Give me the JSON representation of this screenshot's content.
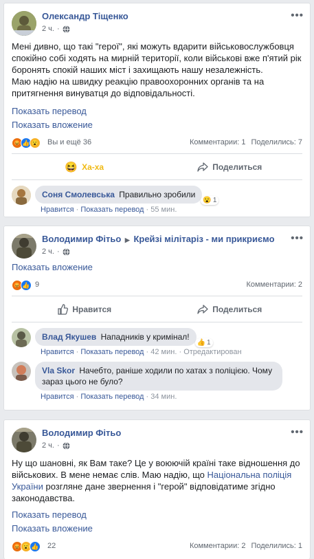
{
  "post1": {
    "author": "Олександр Тіщенко",
    "time": "2 ч.",
    "text_lines": [
      "Мені дивно, що такі \"герої\", які можуть вдарити військовослужбовця",
      "спокійно собі ходять на мирній території, коли військові вже п'ятий рік",
      "боронять спокій наших міст і захищають нашу незалежність.",
      "Маю надію на швидку реакцію правоохоронних органів та на",
      "притягнення винуватця до відповідальності."
    ],
    "see_translation": "Показать перевод",
    "see_attachment": "Показать вложение",
    "reactions_text": "Вы и ещё 36",
    "comments_count": "Комментарии: 1",
    "shares_count": "Поделились: 7",
    "action_reaction": "Ха-ха",
    "action_share": "Поделиться",
    "comments": [
      {
        "name": "Соня Смолевська",
        "text": "Правильно зробили",
        "react_count": "1",
        "like": "Нравится",
        "translate": "Показать перевод",
        "time": "55 мин."
      }
    ]
  },
  "post2": {
    "author": "Володимир Фітьо",
    "group": "Крейзі мілітаріз - ми прикриємо",
    "time": "2 ч.",
    "see_attachment": "Показать вложение",
    "reactions_text": "9",
    "comments_count": "Комментарии: 2",
    "action_like": "Нравится",
    "action_share": "Поделиться",
    "comments": [
      {
        "name": "Влад Якушев",
        "text": "Нападників у кримінал!",
        "react_count": "1",
        "like": "Нравится",
        "translate": "Показать перевод",
        "time": "42 мин.",
        "edited": "Отредактирован"
      },
      {
        "name": "Vla Skor",
        "text": "Начебто, раніше ходили по хатах з поліцією. Чому зараз цього не було?",
        "like": "Нравится",
        "translate": "Показать перевод",
        "time": "34 мин."
      }
    ]
  },
  "post3": {
    "author": "Володимир Фітьо",
    "time": "2 ч.",
    "text_a": "Ну що шановні, як Вам таке? Це у воюючій країні таке відношення до військових. В мене немає слів. Маю надію, що ",
    "text_link": "Національна поліція України",
    "text_b": " розгляне дане звернення і \"герой\" відповідатиме згідно законодавства.",
    "see_translation": "Показать перевод",
    "see_attachment": "Показать вложение",
    "reactions_text": "22",
    "comments_count": "Комментарии: 2",
    "shares_count": "Поделились: 1"
  },
  "icons": {
    "more": "more-dots-icon",
    "globe": "globe-icon",
    "like": "thumbs-up-icon",
    "share": "share-arrow-icon",
    "haha": "haha-emoji-icon",
    "angry": "angry-emoji-icon",
    "wow": "wow-emoji-icon"
  },
  "colors": {
    "link": "#385898",
    "background": "#e9ebee",
    "like_blue": "#1877f2",
    "haha_yellow": "#f0ba15",
    "angry_orange": "#e9710f"
  }
}
